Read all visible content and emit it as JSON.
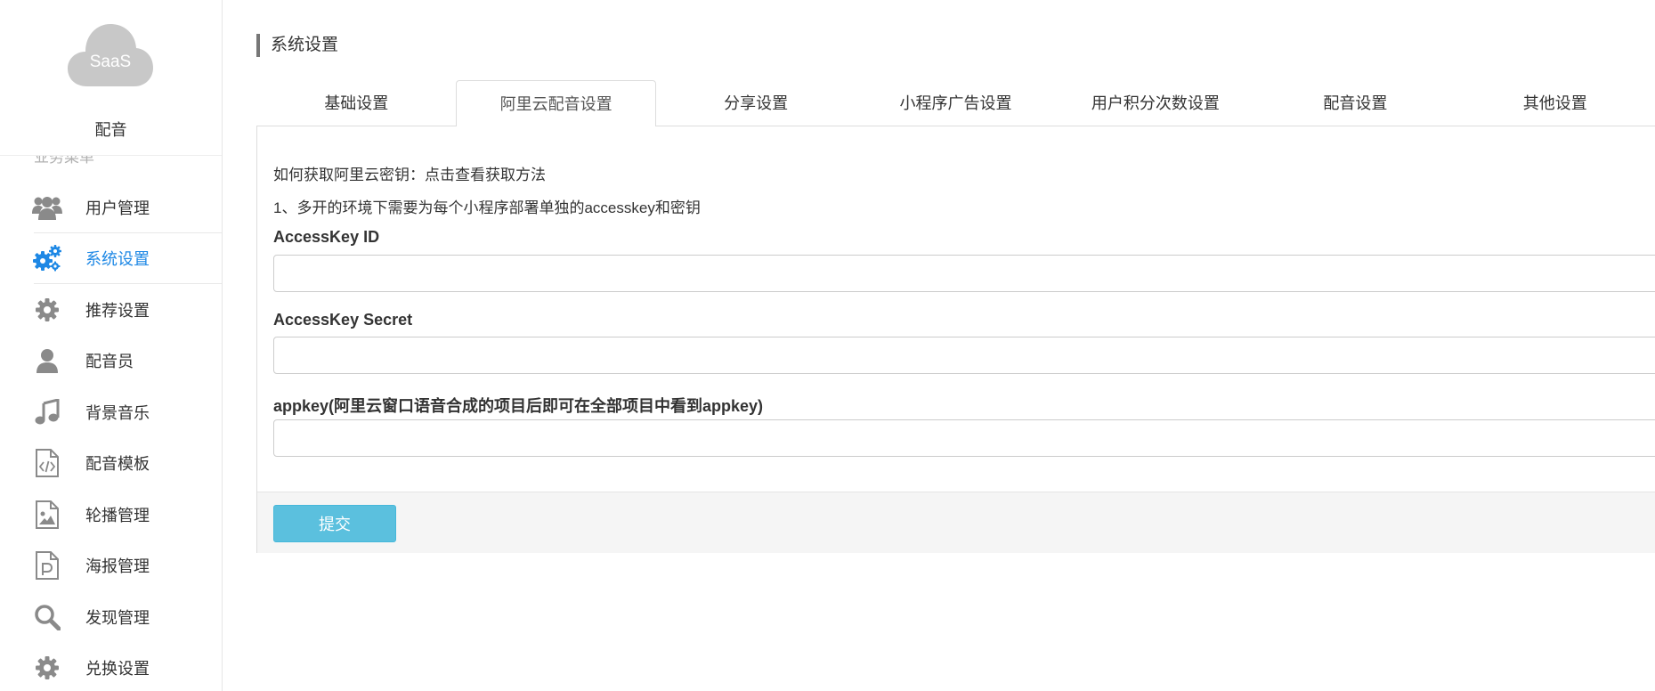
{
  "brand": {
    "logo_text": "SaaS",
    "name": "配音",
    "logo_color": "#c8c8c8"
  },
  "sidebar": {
    "caption": "业务菜单",
    "active_color": "#1e88e5",
    "icon_color": "#8a8a8a",
    "items": [
      {
        "label": "用户管理",
        "icon": "users-icon"
      },
      {
        "label": "系统设置",
        "icon": "gears-icon",
        "active": true
      },
      {
        "label": "推荐设置",
        "icon": "gear-icon"
      },
      {
        "label": "配音员",
        "icon": "user-icon"
      },
      {
        "label": "背景音乐",
        "icon": "music-note-icon"
      },
      {
        "label": "配音模板",
        "icon": "code-file-icon"
      },
      {
        "label": "轮播管理",
        "icon": "image-file-icon"
      },
      {
        "label": "海报管理",
        "icon": "poster-file-icon"
      },
      {
        "label": "发现管理",
        "icon": "search-icon"
      },
      {
        "label": "兑换设置",
        "icon": "gear-icon"
      }
    ]
  },
  "main": {
    "title": "系统设置",
    "tabs": [
      {
        "label": "基础设置"
      },
      {
        "label": "阿里云配音设置",
        "active": true
      },
      {
        "label": "分享设置"
      },
      {
        "label": "小程序广告设置"
      },
      {
        "label": "用户积分次数设置"
      },
      {
        "label": "配音设置"
      },
      {
        "label": "其他设置"
      }
    ],
    "info_line_1": "如何获取阿里云密钥：点击查看获取方法",
    "info_line_2": "1、多开的环境下需要为每个小程序部署单独的accesskey和密钥",
    "fields": [
      {
        "label": "AccessKey ID",
        "value": "",
        "placeholder": ""
      },
      {
        "label": "AccessKey Secret",
        "value": "",
        "placeholder": ""
      },
      {
        "label": "appkey(阿里云窗口语音合成的项目后即可在全部项目中看到appkey)",
        "value": "",
        "placeholder": ""
      }
    ],
    "submit_label": "提交",
    "submit_color": "#5bc0de"
  }
}
